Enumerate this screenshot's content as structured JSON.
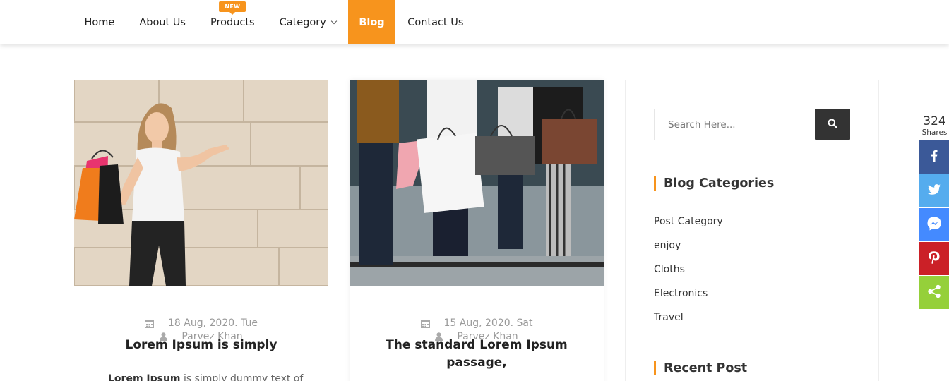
{
  "nav": {
    "items": [
      {
        "label": "Home"
      },
      {
        "label": "About Us"
      },
      {
        "label": "Products",
        "badge": "NEW"
      },
      {
        "label": "Category"
      },
      {
        "label": "Blog",
        "active": true
      },
      {
        "label": "Contact Us"
      }
    ]
  },
  "posts": [
    {
      "date": "18 Aug, 2020. Tue",
      "author": "Parvez Khan",
      "title": "Lorem Ipsum is simply",
      "excerpt_bold": "Lorem Ipsum",
      "excerpt": " is simply dummy text of"
    },
    {
      "date": "15 Aug, 2020. Sat",
      "author": "Parvez Khan",
      "title": "The standard Lorem Ipsum passage,"
    }
  ],
  "sidebar": {
    "search_placeholder": "Search Here...",
    "categories_title": "Blog Categories",
    "categories": [
      "Post Category",
      "enjoy",
      "Cloths",
      "Electronics",
      "Travel"
    ],
    "recent_title": "Recent Post"
  },
  "share": {
    "count": "324",
    "label": "Shares",
    "buttons": [
      {
        "icon": "facebook-icon",
        "color": "#3b5998"
      },
      {
        "icon": "twitter-icon",
        "color": "#55acee"
      },
      {
        "icon": "messenger-icon",
        "color": "#448aff"
      },
      {
        "icon": "pinterest-icon",
        "color": "#cb2027"
      },
      {
        "icon": "share-icon",
        "color": "#95d03a"
      }
    ]
  },
  "colors": {
    "accent": "#f7941d",
    "dark_button": "#333333"
  }
}
